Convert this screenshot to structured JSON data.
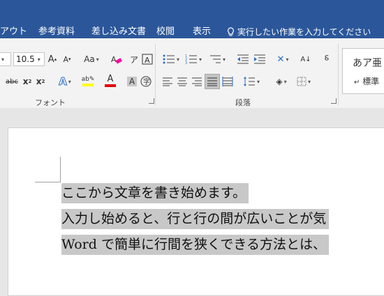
{
  "tabs": [
    "アウト",
    "参考資料",
    "差し込み文書",
    "校閲",
    "表示"
  ],
  "tell_me": "実行したい作業を入力してください",
  "font": {
    "name_value": "",
    "size_value": "10.5",
    "group_label": "フォント"
  },
  "paragraph": {
    "group_label": "段落"
  },
  "styles": {
    "sample": "あア亜",
    "name": "標準"
  },
  "document_lines": [
    "ここから文章を書き始めます。",
    "入力し始めると、行と行の間が広いことが気",
    "Word で簡単に行間を狭くできる方法とは、"
  ],
  "colors": {
    "ribbon_blue": "#2b579a",
    "highlight_yellow": "#ffff00",
    "font_red": "#e00000",
    "selection_gray": "#c8c8c8"
  }
}
